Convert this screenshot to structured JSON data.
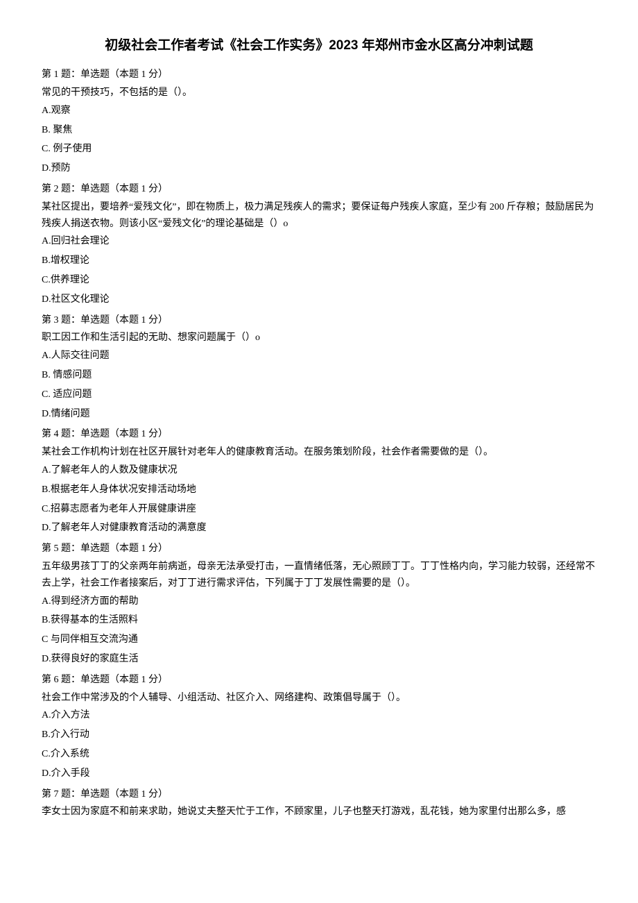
{
  "title": "初级社会工作者考试《社会工作实务》2023 年郑州市金水区高分冲刺试题",
  "questions": [
    {
      "header": "第 1 题：单选题（本题 1 分）",
      "stem": "常见的干预技巧，不包括的是（）。",
      "options": [
        "A.观察",
        "B. 聚焦",
        "C. 例子使用",
        "D.预防"
      ]
    },
    {
      "header": "第 2 题：单选题（本题 1 分）",
      "stem": "某社区提出，要培养“爱残文化”，即在物质上，极力满足残疾人的需求；要保证每户残疾人家庭，至少有 200 斤存粮；鼓励居民为残疾人捐送衣物。则该小区“爱残文化”的理论基础是（）o",
      "options": [
        "A.回归社会理论",
        "B.增权理论",
        "C.供养理论",
        "D.社区文化理论"
      ]
    },
    {
      "header": "第 3 题：单选题（本题 1 分）",
      "stem": "职工因工作和生活引起的无助、想家问题属于（）o",
      "options": [
        "A.人际交往问题",
        "B. 情感问题",
        "C. 适应问题",
        "D.情绪问题"
      ]
    },
    {
      "header": "第 4 题：单选题（本题 1 分）",
      "stem": "某社会工作机构计划在社区开展针对老年人的健康教育活动。在服务策划阶段，社会作者需要做的是（）。",
      "options": [
        "A.了解老年人的人数及健康状况",
        "B.根据老年人身体状况安排活动场地",
        "C.招募志愿者为老年人开展健康讲座",
        "D.了解老年人对健康教育活动的满意度"
      ]
    },
    {
      "header": "第 5 题：单选题（本题 1 分）",
      "stem": "五年级男孩丁丁的父亲两年前病逝，母亲无法承受打击，一直情绪低落，无心照顾丁丁。丁丁性格内向，学习能力较弱，还经常不去上学，社会工作者接案后，对丁丁进行需求评估，下列属于丁丁发展性需要的是（）。",
      "options": [
        "A.得到经济方面的帮助",
        "B.获得基本的生活照料",
        "C 与同伴相互交流沟通",
        "D.获得良好的家庭生活"
      ]
    },
    {
      "header": "第 6 题：单选题（本题 1 分）",
      "stem": "社会工作中常涉及的个人辅导、小组活动、社区介入、网络建构、政策倡导属于（）。",
      "options": [
        "A.介入方法",
        "B.介入行动",
        "C.介入系统",
        "D.介入手段"
      ]
    },
    {
      "header": "第 7 题：单选题（本题 1 分）",
      "stem": "李女士因为家庭不和前来求助，她说丈夫整天忙于工作，不顾家里，儿子也整天打游戏，乱花钱，她为家里付出那么多，感",
      "options": []
    }
  ]
}
